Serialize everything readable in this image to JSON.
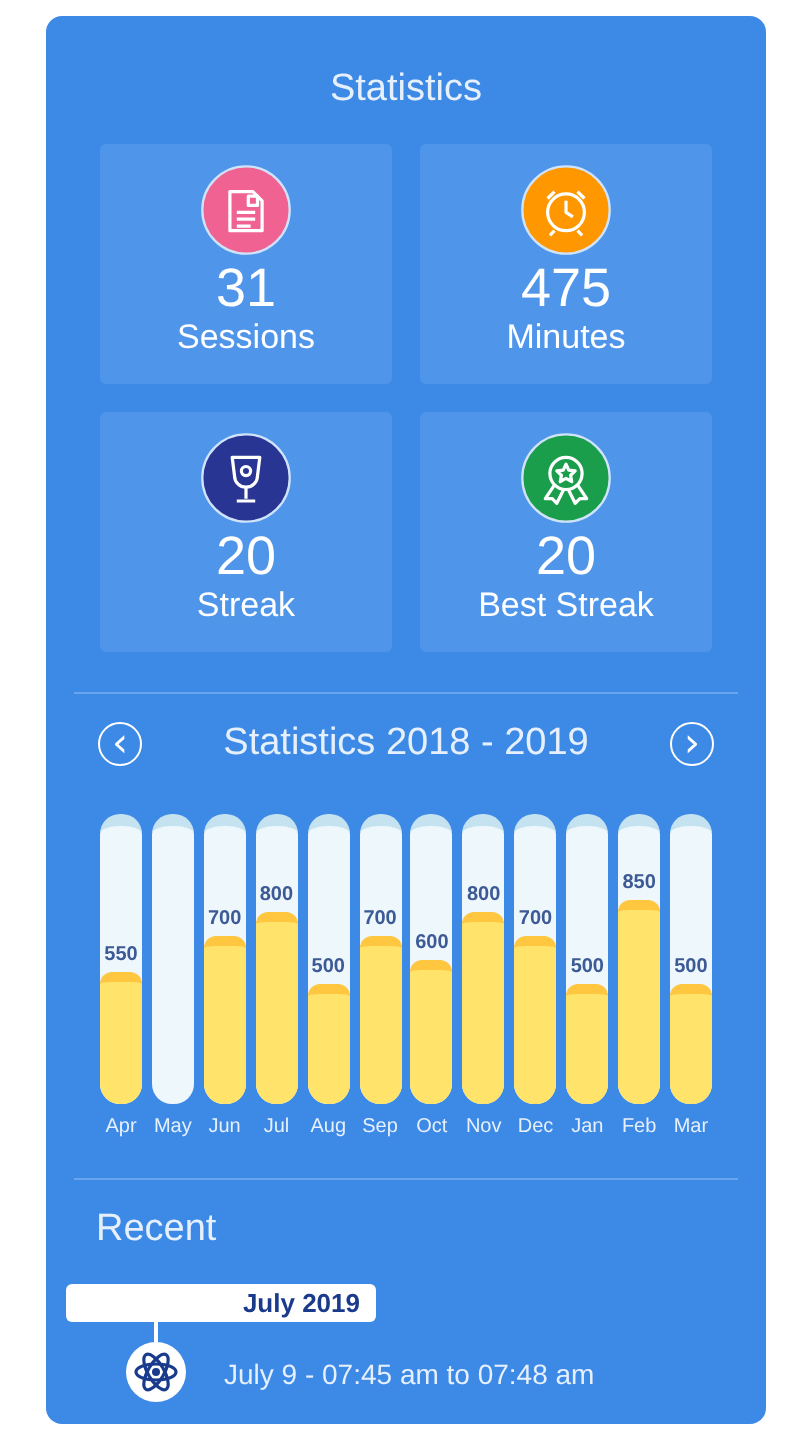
{
  "title": "Statistics",
  "stats": [
    {
      "value": "31",
      "label": "Sessions",
      "kind": "document",
      "color": "#f06292"
    },
    {
      "value": "475",
      "label": "Minutes",
      "kind": "alarm",
      "color": "#ff9800"
    },
    {
      "value": "20",
      "label": "Streak",
      "kind": "trophy",
      "color": "#283593"
    },
    {
      "value": "20",
      "label": "Best Streak",
      "kind": "award",
      "color": "#1b9e4b"
    }
  ],
  "chart": {
    "title": "Statistics 2018 - 2019",
    "prev": "‹",
    "next": "›",
    "chart_data": {
      "type": "bar",
      "categories": [
        "Apr",
        "May",
        "Jun",
        "Jul",
        "Aug",
        "Sep",
        "Oct",
        "Nov",
        "Dec",
        "Jan",
        "Feb",
        "Mar"
      ],
      "values": [
        550,
        null,
        700,
        800,
        500,
        700,
        600,
        800,
        700,
        500,
        850,
        500
      ],
      "data_labels": true
    }
  },
  "recent": {
    "heading": "Recent",
    "month": "July 2019",
    "entries": [
      {
        "text": "July 9 - 07:45 am to 07:48 am"
      }
    ]
  }
}
